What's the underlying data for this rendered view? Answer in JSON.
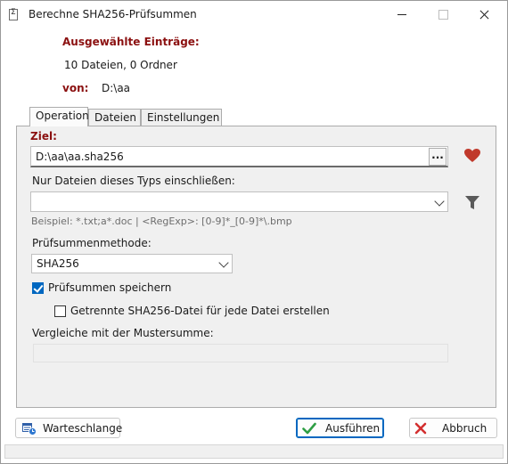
{
  "window": {
    "title": "Berechne SHA256-Prüfsummen"
  },
  "header": {
    "selected_label": "Ausgewählte Einträge:",
    "selected_value": "10 Dateien, 0 Ordner",
    "from_label": "von:",
    "from_value": "D:\\aa"
  },
  "tabs": [
    {
      "label": "Operation",
      "active": true
    },
    {
      "label": "Dateien",
      "active": false
    },
    {
      "label": "Einstellungen",
      "active": false
    }
  ],
  "operation": {
    "target_label": "Ziel:",
    "target_value": "D:\\aa\\aa.sha256",
    "browse_label": "...",
    "filter_label": "Nur Dateien dieses Typs einschließen:",
    "filter_value": "",
    "filter_hint": "Beispiel: *.txt;a*.doc | <RegExp>: [0-9]*_[0-9]*\\.bmp",
    "method_label": "Prüfsummenmethode:",
    "method_value": "SHA256",
    "save_checksums_label": "Prüfsummen speichern",
    "save_checksums_checked": true,
    "separate_file_label": "Getrennte SHA256-Datei für jede Datei erstellen",
    "separate_file_checked": false,
    "compare_label": "Vergleiche mit der Mustersumme:",
    "compare_value": ""
  },
  "buttons": {
    "queue_label": "Warteschlange",
    "run_label": "Ausführen",
    "cancel_label": "Abbruch"
  },
  "colors": {
    "accent": "#0067c0",
    "label_red": "#8b1010",
    "heart": "#c0392b",
    "run_icon": "#2e9e44",
    "cancel_icon": "#d32f2f"
  },
  "icons": {
    "title": "checksum-icon",
    "favorite": "heart-icon",
    "filter": "funnel-icon",
    "queue": "queue-icon",
    "run": "checkmark-icon",
    "cancel": "x-icon"
  }
}
